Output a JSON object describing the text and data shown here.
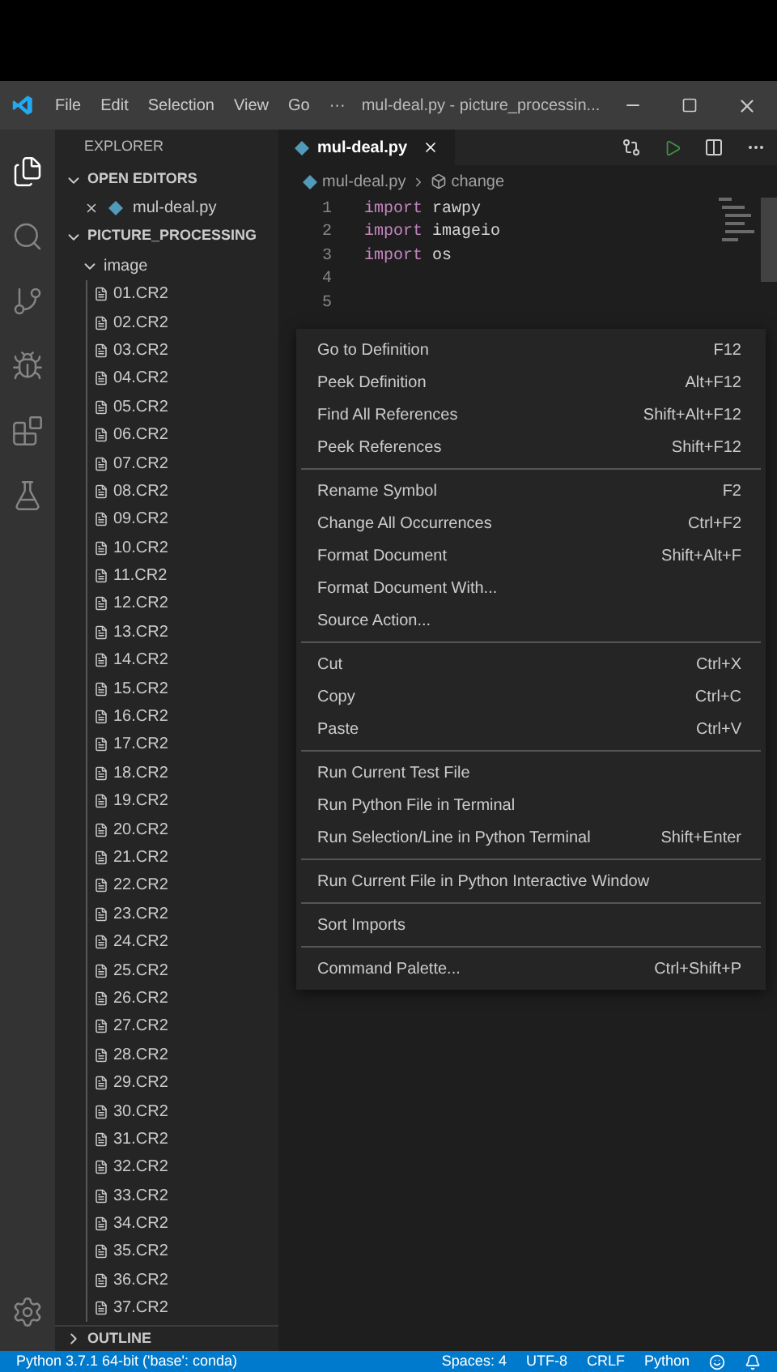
{
  "title_bar": {
    "menu": [
      "File",
      "Edit",
      "Selection",
      "View",
      "Go",
      "···"
    ],
    "title": "mul-deal.py - picture_processin..."
  },
  "activity_bar": {
    "items": [
      {
        "kind": "files",
        "selected": true
      },
      {
        "kind": "search",
        "selected": false
      },
      {
        "kind": "source-control",
        "selected": false
      },
      {
        "kind": "debug",
        "selected": false
      },
      {
        "kind": "extensions",
        "selected": false
      },
      {
        "kind": "testing",
        "selected": false
      }
    ]
  },
  "sidebar": {
    "title": "EXPLORER",
    "open_editors": {
      "label": "OPEN EDITORS",
      "expanded": true,
      "items": [
        {
          "name": "mul-deal.py"
        }
      ]
    },
    "folder": {
      "label": "PICTURE_PROCESSING",
      "expanded": true,
      "children": [
        {
          "label": "image",
          "expanded": true,
          "children": [
            {
              "label": "01.CR2"
            },
            {
              "label": "02.CR2"
            },
            {
              "label": "03.CR2"
            },
            {
              "label": "04.CR2"
            },
            {
              "label": "05.CR2"
            },
            {
              "label": "06.CR2"
            },
            {
              "label": "07.CR2"
            },
            {
              "label": "08.CR2"
            },
            {
              "label": "09.CR2"
            },
            {
              "label": "10.CR2"
            },
            {
              "label": "11.CR2"
            },
            {
              "label": "12.CR2"
            },
            {
              "label": "13.CR2"
            },
            {
              "label": "14.CR2"
            },
            {
              "label": "15.CR2"
            },
            {
              "label": "16.CR2"
            },
            {
              "label": "17.CR2"
            },
            {
              "label": "18.CR2"
            },
            {
              "label": "19.CR2"
            },
            {
              "label": "20.CR2"
            },
            {
              "label": "21.CR2"
            },
            {
              "label": "22.CR2"
            },
            {
              "label": "23.CR2"
            },
            {
              "label": "24.CR2"
            },
            {
              "label": "25.CR2"
            },
            {
              "label": "26.CR2"
            },
            {
              "label": "27.CR2"
            },
            {
              "label": "28.CR2"
            },
            {
              "label": "29.CR2"
            },
            {
              "label": "30.CR2"
            },
            {
              "label": "31.CR2"
            },
            {
              "label": "32.CR2"
            },
            {
              "label": "33.CR2"
            },
            {
              "label": "34.CR2"
            },
            {
              "label": "35.CR2"
            },
            {
              "label": "36.CR2"
            },
            {
              "label": "37.CR2"
            }
          ]
        }
      ]
    },
    "outline": {
      "label": "OUTLINE",
      "expanded": false
    }
  },
  "editor": {
    "tabs": [
      {
        "label": "mul-deal.py",
        "selected": true
      }
    ],
    "breadcrumb": [
      "mul-deal.py",
      "change"
    ],
    "lines": [
      {
        "number": "1",
        "keyword": "import",
        "name": "rawpy"
      },
      {
        "number": "2",
        "keyword": "import",
        "name": "imageio"
      },
      {
        "number": "3",
        "keyword": "import",
        "name": "os"
      },
      {
        "number": "4"
      },
      {
        "number": "5"
      }
    ]
  },
  "context_menu": {
    "groups": [
      [
        {
          "label": "Go to Definition",
          "shortcut": "F12"
        },
        {
          "label": "Peek Definition",
          "shortcut": "Alt+F12"
        },
        {
          "label": "Find All References",
          "shortcut": "Shift+Alt+F12"
        },
        {
          "label": "Peek References",
          "shortcut": "Shift+F12"
        }
      ],
      [
        {
          "label": "Rename Symbol",
          "shortcut": "F2"
        },
        {
          "label": "Change All Occurrences",
          "shortcut": "Ctrl+F2"
        },
        {
          "label": "Format Document",
          "shortcut": "Shift+Alt+F"
        },
        {
          "label": "Format Document With..."
        },
        {
          "label": "Source Action..."
        }
      ],
      [
        {
          "label": "Cut",
          "shortcut": "Ctrl+X"
        },
        {
          "label": "Copy",
          "shortcut": "Ctrl+C"
        },
        {
          "label": "Paste",
          "shortcut": "Ctrl+V"
        }
      ],
      [
        {
          "label": "Run Current Test File"
        },
        {
          "label": "Run Python File in Terminal"
        },
        {
          "label": "Run Selection/Line in Python Terminal",
          "shortcut": "Shift+Enter"
        }
      ],
      [
        {
          "label": "Run Current File in Python Interactive Window"
        }
      ],
      [
        {
          "label": "Sort Imports"
        }
      ],
      [
        {
          "label": "Command Palette...",
          "shortcut": "Ctrl+Shift+P"
        }
      ]
    ]
  },
  "status_bar": {
    "interpreter": "Python 3.7.1 64-bit ('base': conda)",
    "items": [
      "Spaces: 4",
      "UTF-8",
      "CRLF",
      "Python"
    ]
  }
}
